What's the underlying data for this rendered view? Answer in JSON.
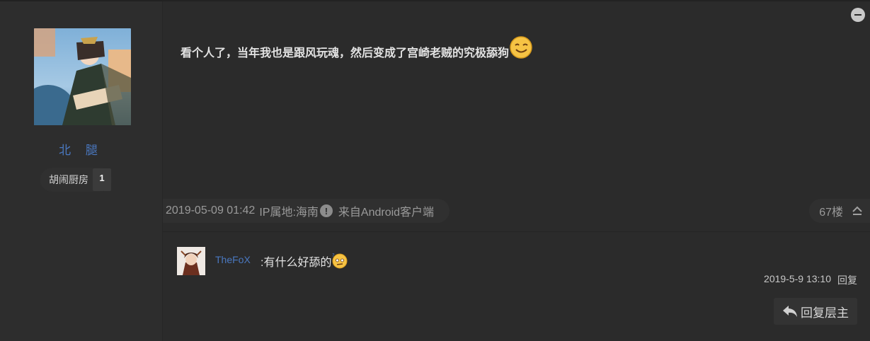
{
  "author": {
    "name": "北 腿",
    "badge_label": "胡闹厨房",
    "badge_level": "1"
  },
  "post": {
    "text": "看个人了，当年我也是跟风玩魂，然后变成了宫崎老贼的究极舔狗",
    "time": "2019-05-09 01:42",
    "ip_location": "IP属地:海南",
    "source": "来自Android客户端",
    "floor": "67楼"
  },
  "comment": {
    "user": "TheFoX",
    "text": ":有什么好舔的",
    "time": "2019-5-9 13:10",
    "reply_label": "回复"
  },
  "actions": {
    "reply_floor_label": "回复层主"
  },
  "colors": {
    "username": "#4a78c0",
    "background": "#2b2b2b"
  },
  "icons": {
    "collapse": "minus-circle-icon",
    "warning": "exclamation-circle-icon",
    "scroll_up": "chevron-up-icon",
    "reply": "reply-arrow-icon",
    "smile": "smile-emoji-icon",
    "puzzled": "puzzled-emoji-icon"
  }
}
